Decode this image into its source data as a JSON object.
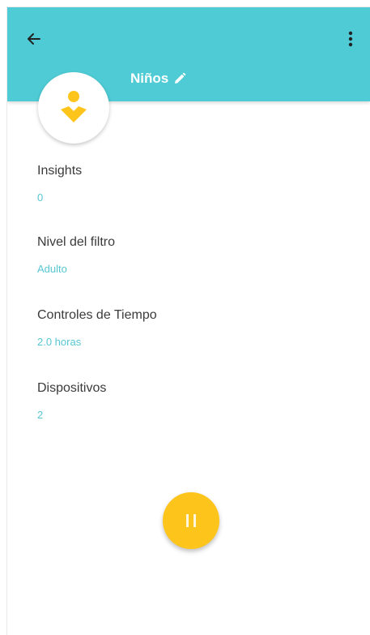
{
  "header": {
    "profile_name": "Niños",
    "bg_color": "#4ecbd5"
  },
  "icons": {
    "back": "arrow-left-icon",
    "menu": "more-vertical-icon",
    "edit": "pencil-icon",
    "avatar": "kid-profile-icon",
    "pause": "pause-icon"
  },
  "sections": [
    {
      "label": "Insights",
      "value": "0"
    },
    {
      "label": "Nivel del filtro",
      "value": "Adulto"
    },
    {
      "label": "Controles de Tiempo",
      "value": "2.0 horas"
    },
    {
      "label": "Dispositivos",
      "value": "2"
    }
  ],
  "colors": {
    "accent": "#57c7d2",
    "fab": "#fdc51c",
    "avatar_icon": "#fdc51c"
  }
}
